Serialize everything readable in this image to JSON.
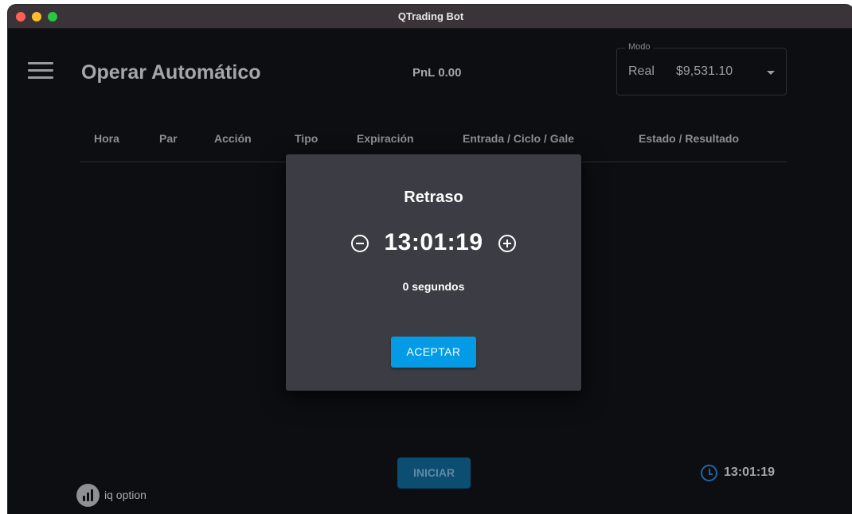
{
  "window": {
    "title": "QTrading Bot"
  },
  "header": {
    "title": "Operar Automático",
    "pnl": "PnL 0.00",
    "mode": {
      "legend": "Modo",
      "account": "Real",
      "balance": "$9,531.10"
    }
  },
  "table": {
    "columns": [
      "Hora",
      "Par",
      "Acción",
      "Tipo",
      "Expiración",
      "Entrada / Ciclo / Gale",
      "Estado / Resultado"
    ]
  },
  "footer": {
    "brand": "iq option",
    "start_label": "INICIAR",
    "clock": "13:01:19"
  },
  "dialog": {
    "title": "Retraso",
    "time": "13:01:19",
    "seconds_label": "0 segundos",
    "accept_label": "ACEPTAR"
  },
  "colors": {
    "background": "#0d0e12",
    "dialog": "#3c3d44",
    "accent": "#039be5",
    "start_button": "#0c4d72",
    "clock_icon": "#1d66a6"
  },
  "icons": [
    "hamburger-menu-icon",
    "dropdown-caret-icon",
    "minus-circle-icon",
    "plus-circle-icon",
    "iq-option-logo-icon",
    "clock-icon"
  ]
}
